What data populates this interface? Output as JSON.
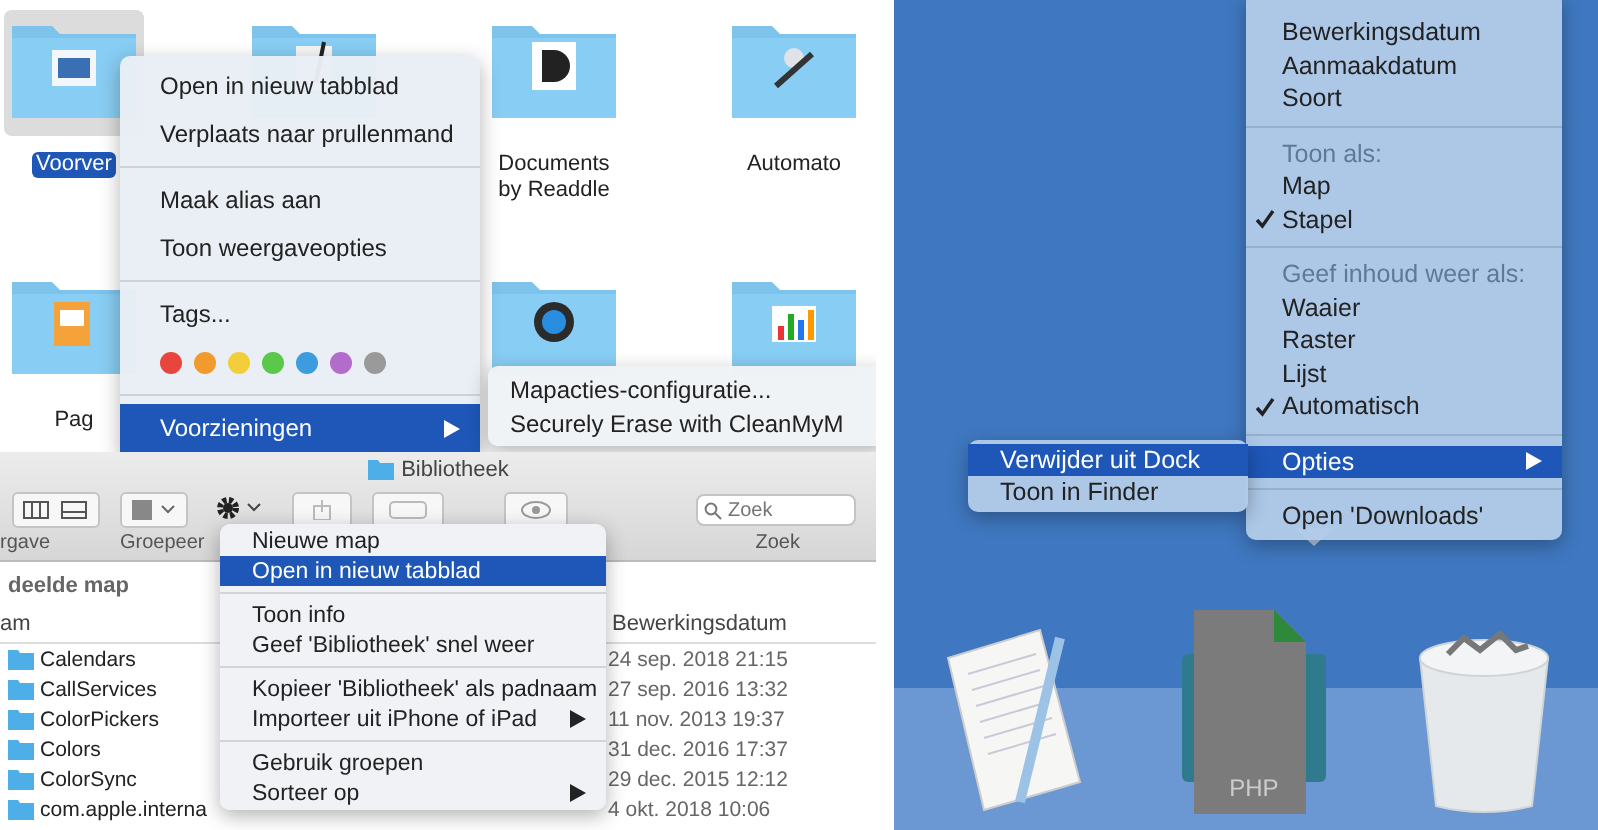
{
  "finder_icons": {
    "items": [
      {
        "label": "Voorver",
        "selected": true
      },
      {
        "selected": false
      },
      {
        "label": "Documents by Readdle",
        "selected": false
      },
      {
        "label": "Automato",
        "selected": false
      },
      {
        "label": "Pag",
        "selected": false
      },
      {
        "selected": false
      },
      {
        "selected": false
      }
    ],
    "context_menu": {
      "items": [
        {
          "kind": "item",
          "label": "Open in nieuw tabblad",
          "selected": false
        },
        {
          "kind": "item",
          "label": "Verplaats naar prullenmand",
          "selected": false
        },
        {
          "kind": "separator"
        },
        {
          "kind": "item",
          "label": "Maak alias aan",
          "selected": false
        },
        {
          "kind": "item",
          "label": "Toon weergaveopties",
          "selected": false
        },
        {
          "kind": "separator"
        },
        {
          "kind": "item",
          "label": "Tags...",
          "selected": false
        },
        {
          "kind": "tags",
          "tags": [
            {
              "color": "#e8453c"
            },
            {
              "color": "#f29a2e"
            },
            {
              "color": "#f2cf3a"
            },
            {
              "color": "#5ac84a"
            },
            {
              "color": "#3d9be0"
            },
            {
              "color": "#b36bcc"
            },
            {
              "color": "#9a9a9a"
            }
          ]
        },
        {
          "kind": "separator"
        },
        {
          "kind": "submenu",
          "label": "Voorzieningen",
          "selected": true
        }
      ]
    },
    "submenu": {
      "items": [
        {
          "kind": "item",
          "label": "Mapacties-configuratie...",
          "selected": false
        },
        {
          "kind": "item",
          "label": "Securely Erase with CleanMyM",
          "selected": false
        }
      ]
    }
  },
  "finder_list": {
    "window_title": "Bibliotheek",
    "toolbar_labels": [
      "rgave",
      "Groepeer",
      "Zoek"
    ],
    "search": {
      "placeholder": "Zoek"
    },
    "sidebar_heading": "deelde map",
    "columns": [
      "am",
      "Bewerkingsdatum"
    ],
    "rows": [
      {
        "name": "Calendars",
        "date": "24 sep. 2018 21:15"
      },
      {
        "name": "CallServices",
        "date": "27 sep. 2016 13:32"
      },
      {
        "name": "ColorPickers",
        "date": "11 nov. 2013 19:37"
      },
      {
        "name": "Colors",
        "date": "31 dec. 2016 17:37"
      },
      {
        "name": "ColorSync",
        "date": "29 dec. 2015 12:12"
      },
      {
        "name": "com.apple.interna",
        "date": "4 okt. 2018 10:06"
      }
    ],
    "action_menu": {
      "items": [
        {
          "kind": "item",
          "label": "Nieuwe map",
          "selected": false
        },
        {
          "kind": "item",
          "label": "Open in nieuw tabblad",
          "selected": true
        },
        {
          "kind": "separator"
        },
        {
          "kind": "item",
          "label": "Toon info",
          "selected": false
        },
        {
          "kind": "item",
          "label": "Geef 'Bibliotheek' snel weer",
          "selected": false
        },
        {
          "kind": "separator"
        },
        {
          "kind": "item",
          "label": "Kopieer 'Bibliotheek' als padnaam",
          "selected": false
        },
        {
          "kind": "submenu",
          "label": "Importeer uit iPhone of iPad",
          "selected": false
        },
        {
          "kind": "separator"
        },
        {
          "kind": "item",
          "label": "Gebruik groepen",
          "selected": false
        },
        {
          "kind": "submenu",
          "label": "Sorteer op",
          "selected": false
        }
      ]
    }
  },
  "dock": {
    "menu": {
      "items": [
        {
          "kind": "item",
          "label": "Bewerkingsdatum",
          "selected": false,
          "checked": false
        },
        {
          "kind": "item",
          "label": "Aanmaakdatum",
          "selected": false,
          "checked": false
        },
        {
          "kind": "item",
          "label": "Soort",
          "selected": false,
          "checked": false
        },
        {
          "kind": "separator"
        },
        {
          "kind": "header",
          "label": "Toon als:"
        },
        {
          "kind": "item",
          "label": "Map",
          "selected": false,
          "checked": false
        },
        {
          "kind": "item",
          "label": "Stapel",
          "selected": false,
          "checked": true
        },
        {
          "kind": "separator"
        },
        {
          "kind": "header",
          "label": "Geef inhoud weer als:"
        },
        {
          "kind": "item",
          "label": "Waaier",
          "selected": false,
          "checked": false
        },
        {
          "kind": "item",
          "label": "Raster",
          "selected": false,
          "checked": false
        },
        {
          "kind": "item",
          "label": "Lijst",
          "selected": false,
          "checked": false
        },
        {
          "kind": "item",
          "label": "Automatisch",
          "selected": false,
          "checked": true
        },
        {
          "kind": "separator"
        },
        {
          "kind": "submenu",
          "label": "Opties",
          "selected": true,
          "checked": false
        },
        {
          "kind": "separator"
        },
        {
          "kind": "item",
          "label": "Open 'Downloads'",
          "selected": false,
          "checked": false
        }
      ]
    },
    "submenu": {
      "items": [
        {
          "kind": "item",
          "label": "Verwijder uit Dock",
          "selected": true
        },
        {
          "kind": "item",
          "label": "Toon in Finder",
          "selected": false
        }
      ]
    },
    "php_label": "PHP"
  }
}
